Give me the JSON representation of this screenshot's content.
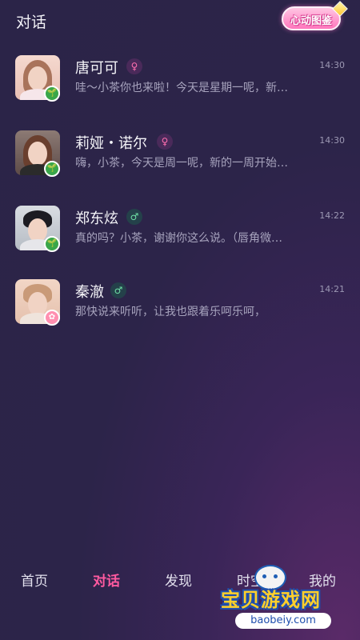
{
  "header": {
    "title": "对话",
    "badge_label": "心动图鉴"
  },
  "chats": [
    {
      "name": "唐可可",
      "gender": "female",
      "gender_symbol": "♀",
      "time": "14:30",
      "preview": "哇～小茶你也来啦！今天是星期一呢，新…",
      "corner": "🌱"
    },
    {
      "name": "莉娅・诺尔",
      "gender": "female",
      "gender_symbol": "♀",
      "time": "14:30",
      "preview": "嗨，小茶，今天是周一呢，新的一周开始…",
      "corner": "🌱"
    },
    {
      "name": "郑东炫",
      "gender": "male",
      "gender_symbol": "♂",
      "time": "14:22",
      "preview": "真的吗？小茶，谢谢你这么说。（唇角微…",
      "corner": "🌱"
    },
    {
      "name": "秦澈",
      "gender": "male",
      "gender_symbol": "♂",
      "time": "14:21",
      "preview": "那快说来听听，让我也跟着乐呵乐呵，",
      "corner": "✿"
    }
  ],
  "tabs": [
    {
      "label": "首页",
      "active": false
    },
    {
      "label": "对话",
      "active": true
    },
    {
      "label": "发现",
      "active": false
    },
    {
      "label": "时空",
      "active": false
    },
    {
      "label": "我的",
      "active": false
    }
  ],
  "watermark": {
    "zh": "宝贝游戏网",
    "en": "baobeiy.com"
  }
}
